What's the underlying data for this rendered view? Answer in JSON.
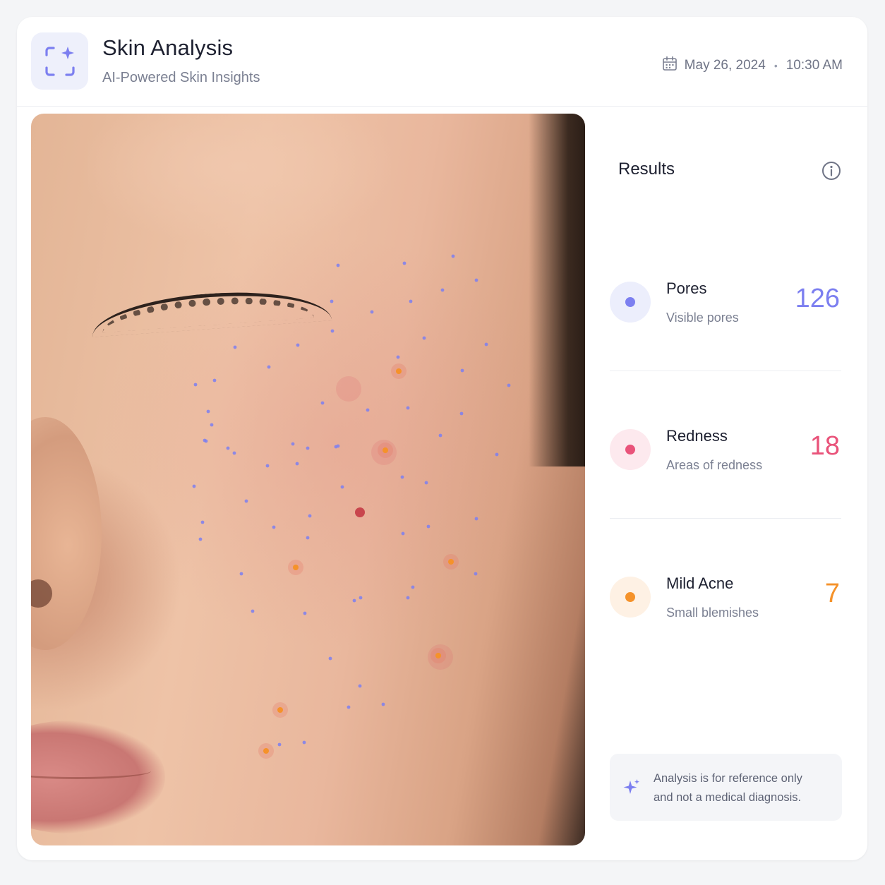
{
  "header": {
    "title": "Skin Analysis",
    "subtitle": "AI-Powered Skin Insights",
    "date": "May 26, 2024",
    "separator": "•",
    "time": "10:30 AM",
    "logo_icon": "scan-sparkle-icon",
    "date_icon": "calendar-icon"
  },
  "colors": {
    "accent": "#7c7ff0",
    "pores": "#7c7ff0",
    "redness": "#e9537a",
    "acne": "#f5922a"
  },
  "results": {
    "title": "Results",
    "info_icon": "info-icon",
    "metrics": [
      {
        "name": "Pores",
        "description": "Visible pores",
        "value": "126",
        "color": "#7c7ff0"
      },
      {
        "name": "Redness",
        "description": "Areas of redness",
        "value": "18",
        "color": "#e9537a"
      },
      {
        "name": "Mild Acne",
        "description": "Small blemishes",
        "value": "7",
        "color": "#f5922a"
      }
    ]
  },
  "disclaimer": {
    "icon": "sparkle-icon",
    "line1": "Analysis is for reference only",
    "line2": "and not a medical diagnosis."
  }
}
